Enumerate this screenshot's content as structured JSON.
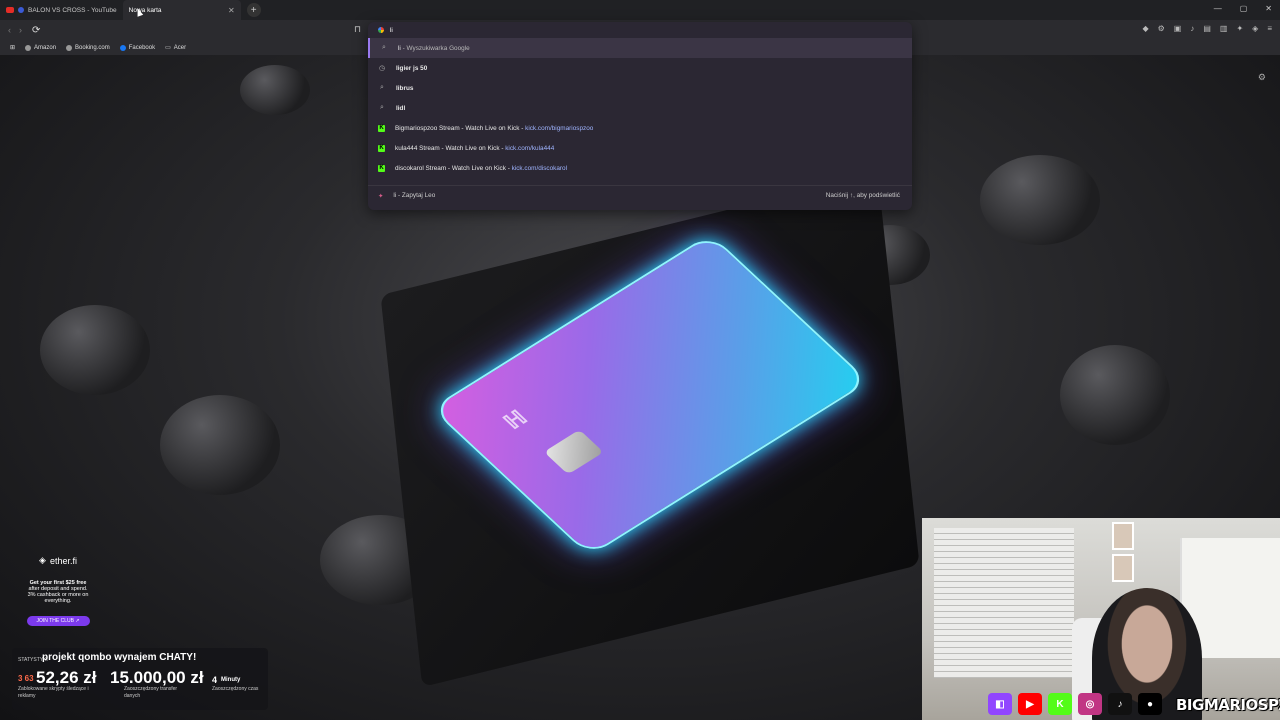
{
  "tabs": [
    {
      "title": "BALON VS CROSS - YouTube",
      "active": false
    },
    {
      "title": "Nowa karta",
      "active": true
    }
  ],
  "new_tab_icon": "plus-icon",
  "window_controls": [
    "minimize-icon",
    "maximize-icon",
    "close-icon"
  ],
  "toolbar": {
    "reload_icon": "reload-icon",
    "bookmark_icon": "bookmark-icon"
  },
  "bookmarks": [
    {
      "label": "Amazon",
      "icon": "amazon-icon"
    },
    {
      "label": "Booking.com",
      "icon": "booking-icon"
    },
    {
      "label": "Facebook",
      "icon": "facebook-icon"
    },
    {
      "label": "Acer",
      "icon": "folder-icon"
    }
  ],
  "omnibox": {
    "value": "li",
    "suggestions": [
      {
        "icon": "search-icon",
        "text": "li",
        "suffix": " - Wyszukiwarka Google",
        "selected": true
      },
      {
        "icon": "history-icon",
        "text": "ligier js 50"
      },
      {
        "icon": "search-icon",
        "text": "librus"
      },
      {
        "icon": "search-icon",
        "text": "lidl"
      },
      {
        "icon": "kick-icon",
        "text": "Bigmariospzoo Stream - Watch Live on Kick",
        "url": "kick.com/bigmariospzoo"
      },
      {
        "icon": "kick-icon",
        "text": "kula444 Stream - Watch Live on Kick",
        "url": "kick.com/kula444"
      },
      {
        "icon": "kick-icon",
        "text": "discokarol Stream - Watch Live on Kick",
        "url": "kick.com/discokarol"
      }
    ],
    "leo": {
      "text": "li",
      "suffix": " - Zapytaj Leo",
      "hint": "Naciśnij ↑, aby podświetlić"
    }
  },
  "promo": {
    "brand": "ether.fi",
    "line1": "Get your first $25 free",
    "line2": "after deposit and spend.",
    "line3": "3% cashback or more on",
    "line4": "everything.",
    "button": "JOIN THE CLUB ↗"
  },
  "stats": {
    "title": "projekt qombo wynajem CHATY!",
    "label": "STATYSTYKI",
    "v1": "3 63",
    "v1_sub": "Zablokowane skrypty śledzące i reklamy",
    "v2": "52,26 zł",
    "v3": "15.000,00 zł",
    "v3_sub": "Zaoszczędzony transfer danych",
    "v4": "4",
    "v4_unit": "Minuty",
    "v4_sub": "Zaoszczędzony czas"
  },
  "streamer": {
    "handle": "BIGMARIOSPZOO",
    "socials": [
      {
        "name": "twitch-icon",
        "color": "#9146ff",
        "glyph": "◧"
      },
      {
        "name": "youtube-icon",
        "color": "#ff0000",
        "glyph": "▶"
      },
      {
        "name": "kick-icon",
        "color": "#53fc18",
        "glyph": "K"
      },
      {
        "name": "instagram-icon",
        "color": "#c13584",
        "glyph": "◎"
      },
      {
        "name": "tiktok-icon",
        "color": "#111111",
        "glyph": "♪"
      },
      {
        "name": "x-icon",
        "color": "#000000",
        "glyph": "●"
      }
    ]
  },
  "colors": {
    "accent": "#9a7af0",
    "kick": "#53fc18",
    "card_glow": "#22e2ff"
  }
}
